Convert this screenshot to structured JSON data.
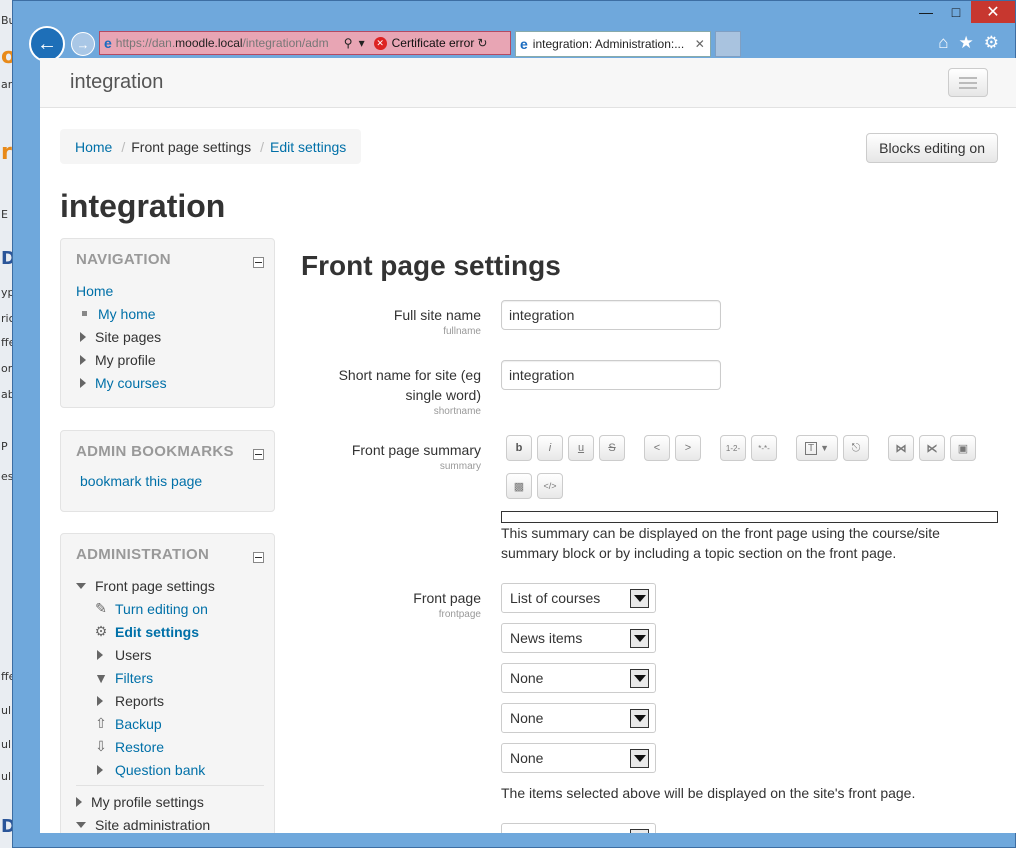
{
  "browser": {
    "url_prefix": "https://dan.",
    "url_domain": "moodle.local",
    "url_suffix": "/integration/adm",
    "cert_error": "Certificate error",
    "tab_title": "integration: Administration:..."
  },
  "navbar": {
    "brand": "integration"
  },
  "breadcrumb": {
    "home": "Home",
    "current": "Front page settings",
    "edit": "Edit settings"
  },
  "blocks_button": "Blocks editing on",
  "page_heading": "integration",
  "navigation": {
    "title": "NAVIGATION",
    "home": "Home",
    "items": [
      {
        "label": "My home"
      },
      {
        "label": "Site pages"
      },
      {
        "label": "My profile"
      },
      {
        "label": "My courses"
      }
    ]
  },
  "admin_bookmarks": {
    "title": "ADMIN BOOKMARKS",
    "link": "bookmark this page"
  },
  "administration": {
    "title": "ADMINISTRATION",
    "front_page_settings": "Front page settings",
    "items": [
      {
        "label": "Turn editing on",
        "icon": "pencil-icon"
      },
      {
        "label": "Edit settings",
        "icon": "gear-icon"
      },
      {
        "label": "Users"
      },
      {
        "label": "Filters",
        "icon": "filter-icon"
      },
      {
        "label": "Reports"
      },
      {
        "label": "Backup",
        "icon": "backup-icon"
      },
      {
        "label": "Restore",
        "icon": "restore-icon"
      },
      {
        "label": "Question bank"
      }
    ],
    "my_profile_settings": "My profile settings",
    "site_administration": "Site administration"
  },
  "form": {
    "title": "Front page settings",
    "fullname": {
      "label": "Full site name",
      "key": "fullname",
      "value": "integration"
    },
    "shortname": {
      "label_line1": "Short name for site (eg",
      "label_line2": "single word)",
      "key": "shortname",
      "value": "integration"
    },
    "summary": {
      "label": "Front page summary",
      "key": "summary",
      "toolbar": [
        "b",
        "i",
        "u",
        "S",
        "<",
        ">",
        "1-2-",
        "*-*-",
        "T",
        "plug",
        "link",
        "unlink",
        "image",
        "media",
        "</>"
      ],
      "help_line1": "This summary can be displayed on the front page using the course/site",
      "help_line2": "summary block or by including a topic section on the front page."
    },
    "frontpage": {
      "label": "Front page",
      "key": "frontpage",
      "selects": [
        "List of courses",
        "News items",
        "None",
        "None",
        "None"
      ],
      "help": "The items selected above will be displayed on the site's front page."
    }
  }
}
